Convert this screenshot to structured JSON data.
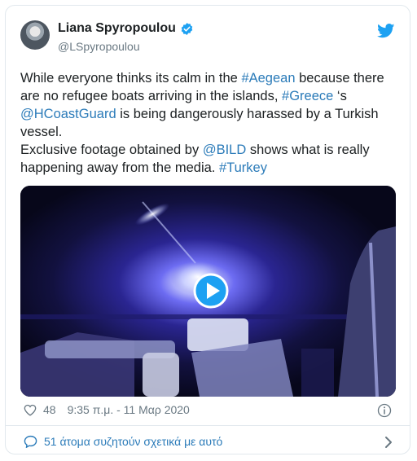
{
  "author": {
    "display_name": "Liana Spyropoulou",
    "handle": "@LSpyropoulou"
  },
  "tweet": {
    "segments": [
      {
        "text": "While everyone thinks its calm in the ",
        "link": false
      },
      {
        "text": "#Aegean",
        "link": true
      },
      {
        "text": " because there are no refugee boats arriving in the islands, ",
        "link": false
      },
      {
        "text": "#Greece",
        "link": true
      },
      {
        "text": " ‘s ",
        "link": false
      },
      {
        "text": "@HCoastGuard",
        "link": true
      },
      {
        "text": " is being dangerously harassed by a Turkish vessel.\nExclusive footage obtained by ",
        "link": false
      },
      {
        "text": "@BILD",
        "link": true
      },
      {
        "text": " shows what is really happening away from the media. ",
        "link": false
      },
      {
        "text": "#Turkey",
        "link": true
      }
    ]
  },
  "meta": {
    "likes": "48",
    "timestamp": "9:35 π.μ. - 11 Μαρ 2020"
  },
  "footer": {
    "discussion": "51 άτομα συζητούν σχετικά με αυτό"
  },
  "colors": {
    "link": "#2b7bb9",
    "twitter_blue": "#1da1f2",
    "muted": "#697882"
  },
  "icons": [
    "verified-badge-icon",
    "twitter-bird-icon",
    "play-icon",
    "heart-icon",
    "info-icon",
    "comment-bubble-icon",
    "chevron-right-icon"
  ]
}
